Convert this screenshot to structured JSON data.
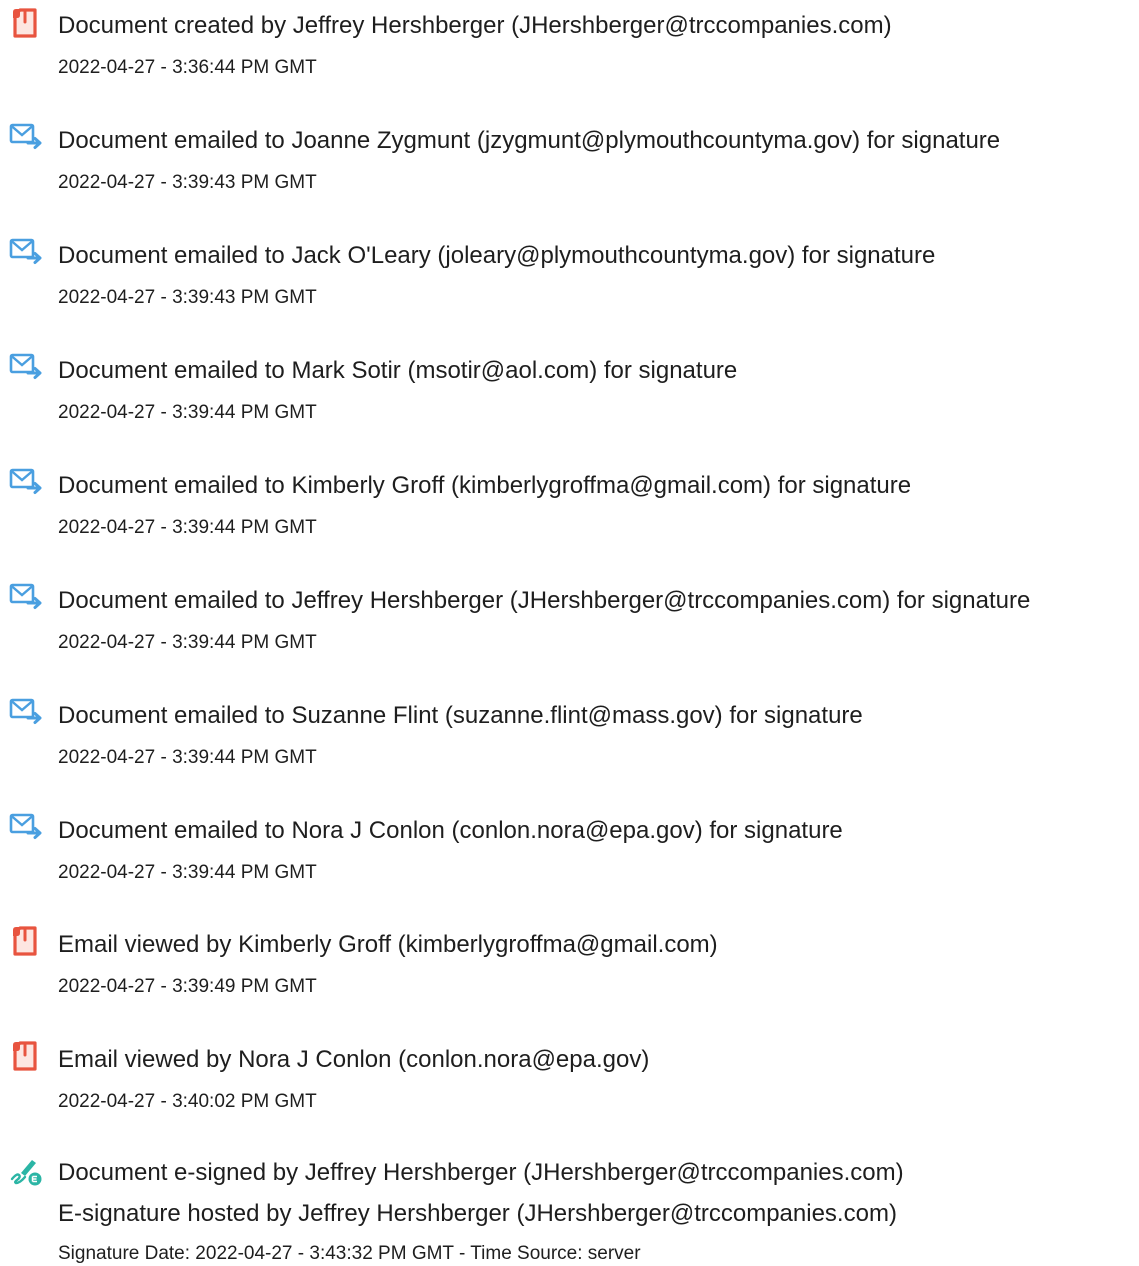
{
  "events": [
    {
      "icon": "document-icon",
      "title": "Document created by Jeffrey Hershberger (JHershberger@trccompanies.com)",
      "timestamp": "2022-04-27 - 3:36:44 PM GMT"
    },
    {
      "icon": "email-send-icon",
      "title": "Document emailed to Joanne Zygmunt (jzygmunt@plymouthcountyma.gov) for signature",
      "timestamp": "2022-04-27 - 3:39:43 PM GMT"
    },
    {
      "icon": "email-send-icon",
      "title": "Document emailed to Jack O'Leary (joleary@plymouthcountyma.gov) for signature",
      "timestamp": "2022-04-27 - 3:39:43 PM GMT"
    },
    {
      "icon": "email-send-icon",
      "title": "Document emailed to Mark Sotir (msotir@aol.com) for signature",
      "timestamp": "2022-04-27 - 3:39:44 PM GMT"
    },
    {
      "icon": "email-send-icon",
      "title": "Document emailed to Kimberly Groff (kimberlygroffma@gmail.com) for signature",
      "timestamp": "2022-04-27 - 3:39:44 PM GMT"
    },
    {
      "icon": "email-send-icon",
      "title": "Document emailed to Jeffrey Hershberger (JHershberger@trccompanies.com) for signature",
      "timestamp": "2022-04-27 - 3:39:44 PM GMT"
    },
    {
      "icon": "email-send-icon",
      "title": "Document emailed to Suzanne Flint (suzanne.flint@mass.gov) for signature",
      "timestamp": "2022-04-27 - 3:39:44 PM GMT"
    },
    {
      "icon": "email-send-icon",
      "title": "Document emailed to Nora J Conlon (conlon.nora@epa.gov) for signature",
      "timestamp": "2022-04-27 - 3:39:44 PM GMT"
    },
    {
      "icon": "document-icon",
      "title": "Email viewed by Kimberly Groff (kimberlygroffma@gmail.com)",
      "timestamp": "2022-04-27 - 3:39:49 PM GMT"
    },
    {
      "icon": "document-icon",
      "title": "Email viewed by Nora J Conlon (conlon.nora@epa.gov)",
      "timestamp": "2022-04-27 - 3:40:02 PM GMT"
    }
  ],
  "signed_event": {
    "icon": "esign-pen-icon",
    "title": "Document e-signed by Jeffrey Hershberger (JHershberger@trccompanies.com)",
    "hosted": "E-signature hosted by Jeffrey Hershberger (JHershberger@trccompanies.com)",
    "signature_date": "Signature Date: 2022-04-27 - 3:43:32 PM GMT - Time Source: server"
  },
  "colors": {
    "document_icon": "#e8543f",
    "email_icon": "#4a9fe0",
    "esign_icon": "#2bb5a5"
  }
}
